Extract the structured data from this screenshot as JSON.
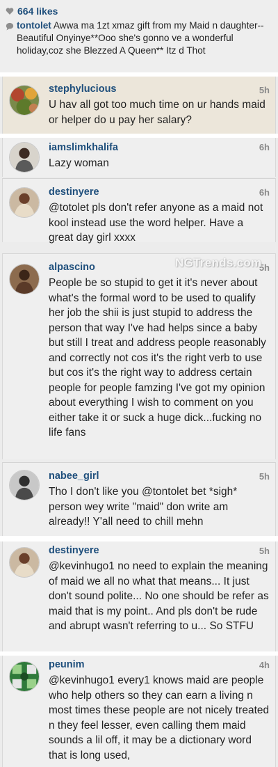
{
  "post": {
    "likes": "664 likes",
    "caption_user": "tontolet",
    "caption_text": "Awwa ma 1zt xmaz gift from my Maid n daughter--Beautiful Onyinye**Ooo she's gonno ve a wonderful holiday,coz she Blezzed A Queen** Itz d Thot"
  },
  "watermark": "NGTrends.com",
  "comments": [
    {
      "username": "stephylucious",
      "time": "5h",
      "text": "U hav all got too much time on ur hands maid or helper do u pay her salary?"
    },
    {
      "username": "iamslimkhalifa",
      "time": "6h",
      "text": "Lazy woman"
    },
    {
      "username": "destinyere",
      "time": "6h",
      "text": "@totolet pls don't refer anyone as a maid not kool instead use the word helper. Have a great day girl xxxx"
    },
    {
      "username": "alpascino",
      "time": "5h",
      "text": "People be so stupid to get it it's never about what's the formal word to be used to qualify her job the shii is just stupid to address the person that way I've had helps since a baby but still I treat and address people reasonably and correctly not cos it's the right verb to use but cos it's the right way to address certain people for people famzing I've got my opinion about everything I wish to comment on you either take it or suck a huge dick...fucking no life fans"
    },
    {
      "username": "nabee_girl",
      "time": "5h",
      "text": "Tho I don't like you @tontolet bet *sigh* person wey write \"maid\" don write am already!! Y'all need to chill mehn"
    },
    {
      "username": "destinyere",
      "time": "5h",
      "text": "@kevinhugo1 no need to explain the meaning of maid we all no what that means... It just don't sound polite... No one should be refer as maid that is my point.. And pls don't be rude and abrupt wasn't  referring to u... So STFU"
    },
    {
      "username": "peunim",
      "time": "4h",
      "text": "@kevinhugo1 every1 knows maid are people who help others so they can earn a living n most times these people are not nicely treated n they feel lesser, even calling them  maid sounds a lil off, it may be a dictionary word that is long used,"
    }
  ]
}
